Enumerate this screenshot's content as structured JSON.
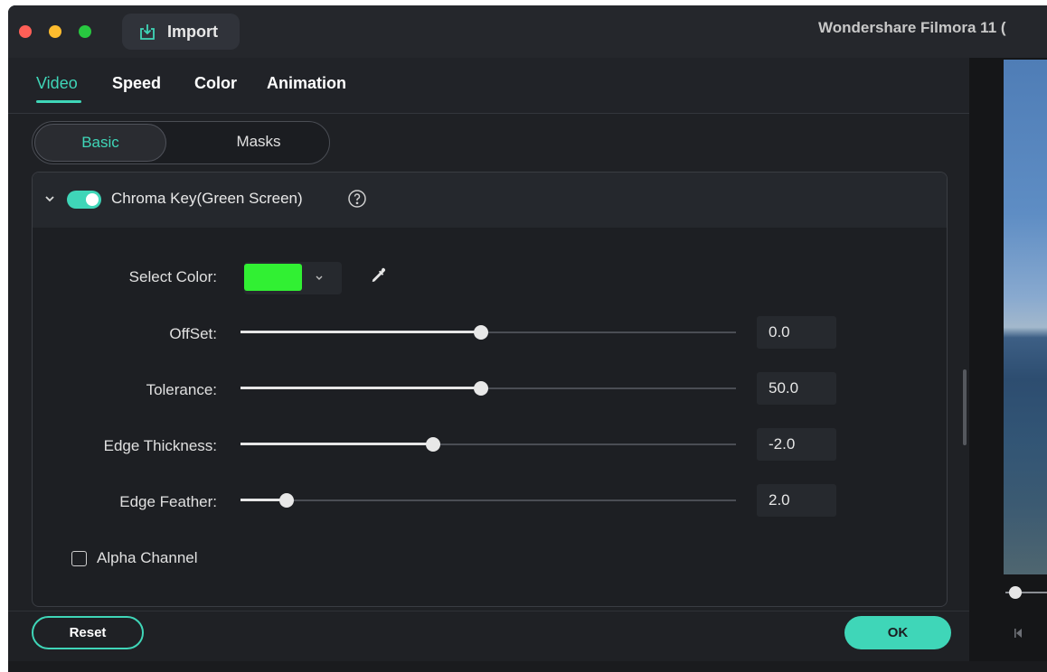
{
  "window": {
    "title": "Wondershare Filmora 11 (",
    "import_label": "Import"
  },
  "tabs": [
    {
      "label": "Video",
      "active": true
    },
    {
      "label": "Speed",
      "active": false
    },
    {
      "label": "Color",
      "active": false
    },
    {
      "label": "Animation",
      "active": false
    }
  ],
  "subtabs": [
    {
      "label": "Basic",
      "active": true
    },
    {
      "label": "Masks",
      "active": false
    }
  ],
  "chroma_key": {
    "title": "Chroma Key(Green Screen)",
    "enabled": true,
    "select_color_label": "Select Color:",
    "selected_color": "#31f033",
    "sliders": [
      {
        "label": "OffSet:",
        "value": "0.0",
        "fill_fraction": 0.486
      },
      {
        "label": "Tolerance:",
        "value": "50.0",
        "fill_fraction": 0.486
      },
      {
        "label": "Edge Thickness:",
        "value": "-2.0",
        "fill_fraction": 0.388
      },
      {
        "label": "Edge Feather:",
        "value": "2.0",
        "fill_fraction": 0.093
      }
    ],
    "alpha_channel_label": "Alpha Channel",
    "alpha_channel_checked": false
  },
  "footer": {
    "reset_label": "Reset",
    "ok_label": "OK"
  },
  "colors": {
    "accent": "#3fd6b8",
    "panel_bg": "#1f2125"
  }
}
